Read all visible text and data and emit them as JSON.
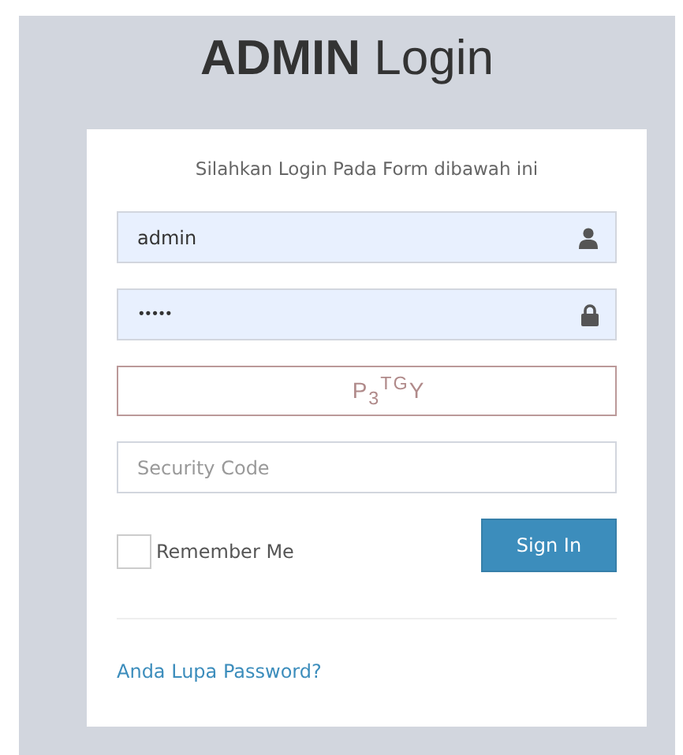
{
  "title": "**ADMIN** Login",
  "subtitle": "Silahkan Login Pada Form dibawah ini",
  "username": {
    "value": "admin"
  },
  "password": {
    "value": "•••••"
  },
  "captcha": "P$_{3}$$^{TG}$Y",
  "security_code": {
    "placeholder": "Security Code"
  },
  "remember_me": {
    "label": "Remember Me",
    "checked": false
  },
  "sign_in": "Sign In",
  "forgot_link": "Anda Lupa Password?"
}
